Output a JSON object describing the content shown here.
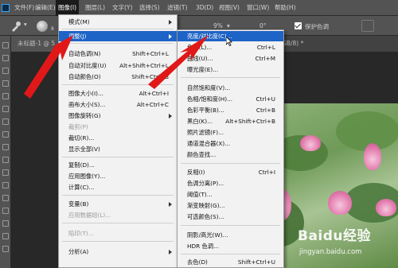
{
  "menubar": {
    "items": [
      "文件(F)",
      "编辑(E)",
      "图像(I)",
      "图层(L)",
      "文字(Y)",
      "选择(S)",
      "滤镜(T)",
      "3D(D)",
      "视图(V)",
      "窗口(W)",
      "帮助(H)"
    ]
  },
  "options_bar": {
    "brush_size": "8",
    "flow_value": "9%",
    "angle_value": "0°",
    "protect_tones_label": "保护色调"
  },
  "tabs": {
    "document_tab": "未标题-1 @ 5",
    "second_tab_suffix": "GB/8) *"
  },
  "image_menu": {
    "items": [
      {
        "label": "模式(M)",
        "shortcut": "",
        "submenu": true,
        "state": "normal"
      },
      {
        "label": "调整(J)",
        "shortcut": "",
        "submenu": true,
        "state": "highlighted"
      },
      {
        "label": "自动色调(N)",
        "shortcut": "Shift+Ctrl+L",
        "state": "normal"
      },
      {
        "label": "自动对比度(U)",
        "shortcut": "Alt+Shift+Ctrl+L",
        "state": "normal"
      },
      {
        "label": "自动颜色(O)",
        "shortcut": "Shift+Ctrl+B",
        "state": "normal"
      },
      {
        "label": "图像大小(I)...",
        "shortcut": "Alt+Ctrl+I",
        "state": "normal"
      },
      {
        "label": "画布大小(S)...",
        "shortcut": "Alt+Ctrl+C",
        "state": "normal"
      },
      {
        "label": "图像旋转(G)",
        "shortcut": "",
        "submenu": true,
        "state": "normal"
      },
      {
        "label": "裁剪(P)",
        "shortcut": "",
        "state": "disabled"
      },
      {
        "label": "裁切(R)...",
        "shortcut": "",
        "state": "normal"
      },
      {
        "label": "显示全部(V)",
        "shortcut": "",
        "state": "normal"
      },
      {
        "label": "复制(D)...",
        "shortcut": "",
        "state": "normal"
      },
      {
        "label": "应用图像(Y)...",
        "shortcut": "",
        "state": "normal"
      },
      {
        "label": "计算(C)...",
        "shortcut": "",
        "state": "normal"
      },
      {
        "label": "变量(B)",
        "shortcut": "",
        "submenu": true,
        "state": "normal"
      },
      {
        "label": "应用数据组(L)...",
        "shortcut": "",
        "state": "disabled"
      },
      {
        "label": "陷印(T)...",
        "shortcut": "",
        "state": "disabled"
      },
      {
        "label": "分析(A)",
        "shortcut": "",
        "submenu": true,
        "state": "normal"
      }
    ]
  },
  "adjust_menu": {
    "items": [
      {
        "label": "亮度/对比度(C)...",
        "shortcut": "",
        "state": "highlighted"
      },
      {
        "label": "色阶(L)...",
        "shortcut": "Ctrl+L",
        "state": "normal"
      },
      {
        "label": "曲线(U)...",
        "shortcut": "Ctrl+M",
        "state": "normal"
      },
      {
        "label": "曝光度(E)...",
        "shortcut": "",
        "state": "normal"
      },
      {
        "label": "自然饱和度(V)...",
        "shortcut": "",
        "state": "normal"
      },
      {
        "label": "色相/饱和度(H)...",
        "shortcut": "Ctrl+U",
        "state": "normal"
      },
      {
        "label": "色彩平衡(B)...",
        "shortcut": "Ctrl+B",
        "state": "normal"
      },
      {
        "label": "黑白(K)...",
        "shortcut": "Alt+Shift+Ctrl+B",
        "state": "normal"
      },
      {
        "label": "照片滤镜(F)...",
        "shortcut": "",
        "state": "normal"
      },
      {
        "label": "通道混合器(X)...",
        "shortcut": "",
        "state": "normal"
      },
      {
        "label": "颜色查找...",
        "shortcut": "",
        "state": "normal"
      },
      {
        "label": "反相(I)",
        "shortcut": "Ctrl+I",
        "state": "normal"
      },
      {
        "label": "色调分离(P)...",
        "shortcut": "",
        "state": "normal"
      },
      {
        "label": "阈值(T)...",
        "shortcut": "",
        "state": "normal"
      },
      {
        "label": "渐变映射(G)...",
        "shortcut": "",
        "state": "normal"
      },
      {
        "label": "可选颜色(S)...",
        "shortcut": "",
        "state": "normal"
      },
      {
        "label": "阴影/高光(W)...",
        "shortcut": "",
        "state": "normal"
      },
      {
        "label": "HDR 色调...",
        "shortcut": "",
        "state": "normal"
      },
      {
        "label": "去色(D)",
        "shortcut": "Shift+Ctrl+U",
        "state": "normal"
      }
    ]
  },
  "watermark": {
    "brand": "Baidu经验",
    "url": "jingyan.baidu.com"
  },
  "colors": {
    "menu_highlight": "#1e63c6",
    "annotation_arrow": "#e01818",
    "app_background": "#535353"
  }
}
